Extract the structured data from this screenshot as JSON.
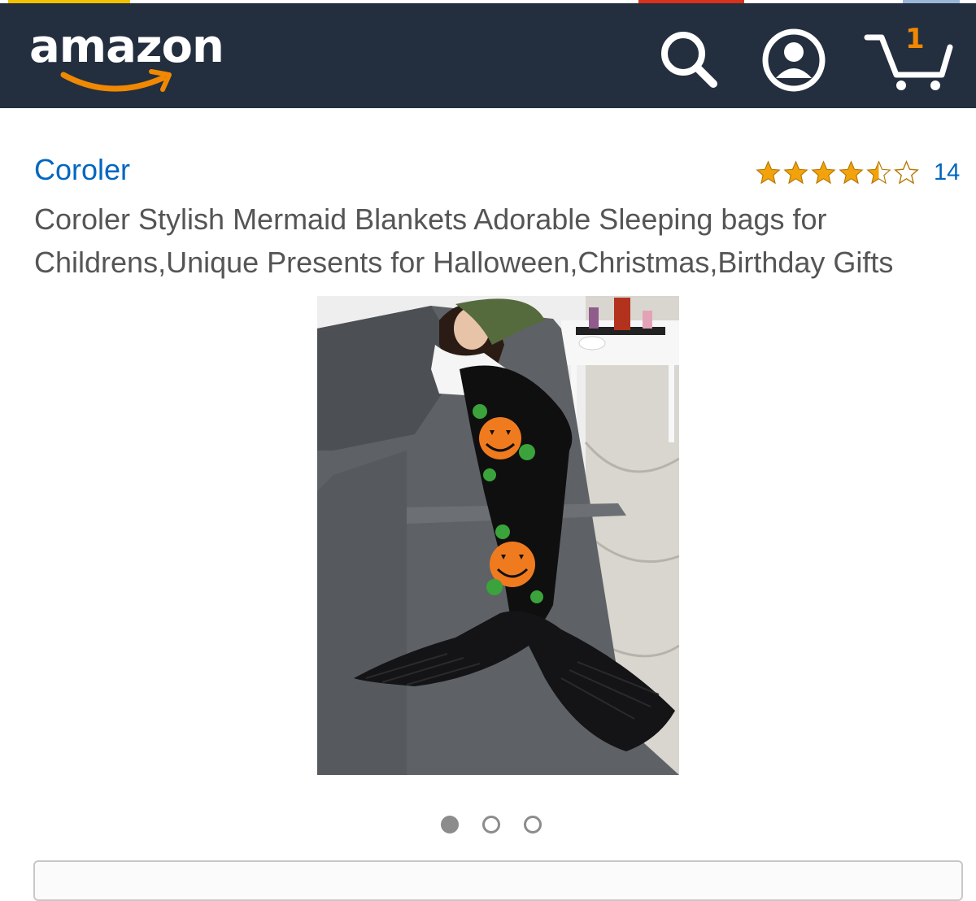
{
  "colors": {
    "header_bg": "#232f3e",
    "accent_orange": "#f08804",
    "link_blue": "#0066c0",
    "star_gold": "#f2a30b",
    "title_gray": "#555555"
  },
  "header": {
    "logo_text": "amazon",
    "icons": [
      "search-icon",
      "account-icon",
      "cart-icon"
    ],
    "cart_count": "1"
  },
  "product": {
    "brand": "Coroler",
    "rating": 4.5,
    "rating_max": 5,
    "rating_count": "14",
    "title": "Coroler Stylish Mermaid Blankets Adorable Sleeping bags for Childrens,Unique Presents for Halloween,Christmas,Birthday Gifts"
  },
  "carousel": {
    "total": 3,
    "active_index": 0
  }
}
